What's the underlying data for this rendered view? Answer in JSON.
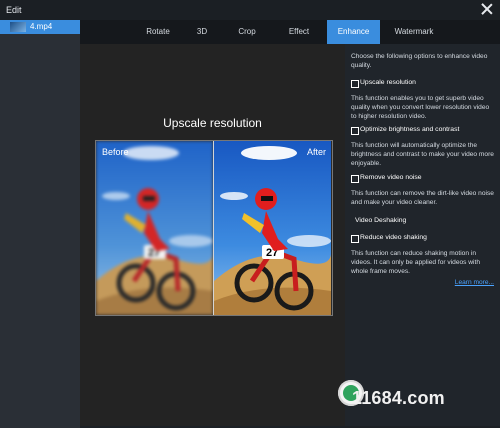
{
  "window": {
    "title": "Edit"
  },
  "sidebar": {
    "file": {
      "name": "4.mp4"
    }
  },
  "tabs": [
    {
      "label": "Rotate"
    },
    {
      "label": "3D"
    },
    {
      "label": "Crop"
    },
    {
      "label": "Effect"
    },
    {
      "label": "Enhance"
    },
    {
      "label": "Watermark"
    }
  ],
  "active_tab": "Enhance",
  "preview": {
    "title": "Upscale resolution",
    "before_label": "Before",
    "after_label": "After",
    "bike_number": "27"
  },
  "panel": {
    "intro": "Choose the following options to enhance video quality.",
    "options": [
      {
        "label": "Upscale resolution",
        "description": "This function enables you to get superb video quality when you convert lower resolution video to higher resolution video.",
        "checked": false
      },
      {
        "label": "Optimize brightness and contrast",
        "description": "This function will automatically optimize the brightness and contrast to make your video more enjoyable.",
        "checked": false
      },
      {
        "label": "Remove video noise",
        "description": "This function can remove the dirt-like video noise and make your video cleaner.",
        "checked": false
      }
    ],
    "deshake": {
      "section_title": "Video Deshaking",
      "label": "Reduce video shaking",
      "description": "This function can reduce shaking motion in videos. It can only be applied for videos with whole frame moves.",
      "checked": false
    },
    "learn_more": "Learn more..."
  },
  "watermark": {
    "text": "11684.com"
  },
  "colors": {
    "accent": "#3a8dde",
    "link": "#4aa3ff",
    "background": "#1c2025"
  }
}
